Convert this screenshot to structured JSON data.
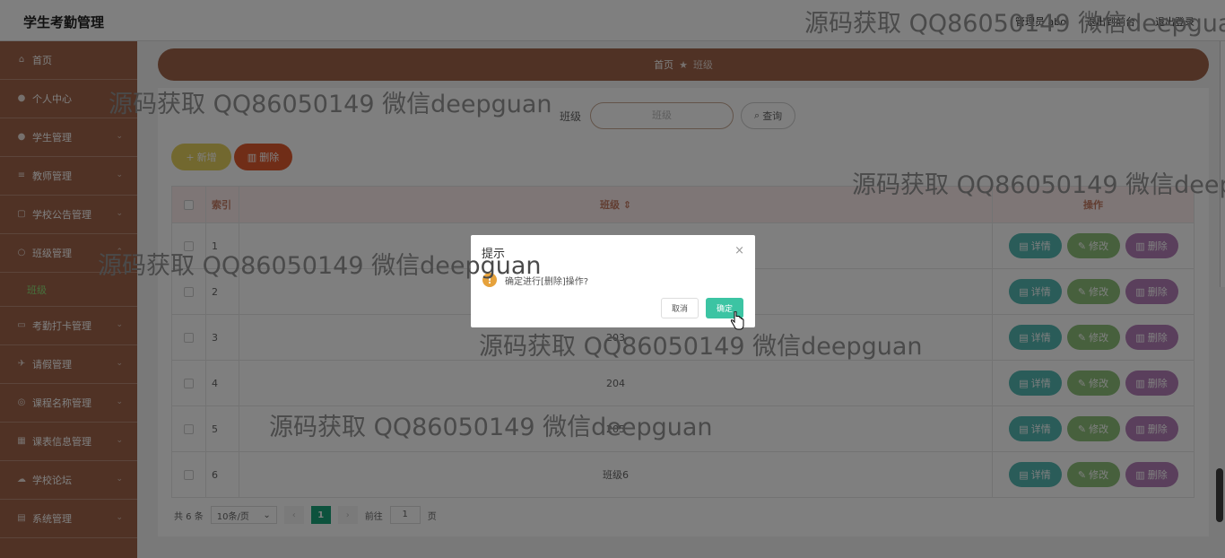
{
  "header": {
    "app_title": "学生考勤管理",
    "user": "管理员 abo",
    "logout": "退出到前台",
    "exit": "退出登录"
  },
  "sidebar": {
    "items": [
      {
        "label": "首页",
        "icon": "home-icon",
        "has_arrow": false
      },
      {
        "label": "个人中心",
        "icon": "user-icon",
        "has_arrow": false
      },
      {
        "label": "学生管理",
        "icon": "student-icon",
        "has_arrow": true
      },
      {
        "label": "教师管理",
        "icon": "teacher-icon",
        "has_arrow": true
      },
      {
        "label": "学校公告管理",
        "icon": "notice-icon",
        "has_arrow": true
      },
      {
        "label": "班级管理",
        "icon": "class-icon",
        "has_arrow": true
      },
      {
        "label": "考勤打卡管理",
        "icon": "checkin-icon",
        "has_arrow": true
      },
      {
        "label": "请假管理",
        "icon": "leave-icon",
        "has_arrow": true
      },
      {
        "label": "课程名称管理",
        "icon": "course-icon",
        "has_arrow": true
      },
      {
        "label": "课表信息管理",
        "icon": "schedule-icon",
        "has_arrow": true
      },
      {
        "label": "学校论坛",
        "icon": "forum-icon",
        "has_arrow": true
      },
      {
        "label": "系统管理",
        "icon": "system-icon",
        "has_arrow": true
      }
    ],
    "submenu_label": "班级"
  },
  "breadcrumb": {
    "home": "首页",
    "separator": "★",
    "current": "班级"
  },
  "search": {
    "label": "班级",
    "placeholder": "班级",
    "button": "查询"
  },
  "actions": {
    "add": "新增",
    "delete": "删除"
  },
  "table": {
    "headers": {
      "index": "索引",
      "name": "班级 ⇕",
      "ops": "操作"
    },
    "rows": [
      {
        "index": "1",
        "name": ""
      },
      {
        "index": "2",
        "name": ""
      },
      {
        "index": "3",
        "name": "203"
      },
      {
        "index": "4",
        "name": "204"
      },
      {
        "index": "5",
        "name": "205"
      },
      {
        "index": "6",
        "name": "班级6"
      }
    ],
    "op_labels": {
      "detail": "详情",
      "edit": "修改",
      "delete": "删除"
    }
  },
  "pagination": {
    "total": "共 6 条",
    "page_size": "10条/页",
    "current": "1",
    "goto_prefix": "前往",
    "goto_value": "1",
    "goto_suffix": "页"
  },
  "dialog": {
    "title": "提示",
    "message": "确定进行[删除]操作?",
    "cancel": "取消",
    "confirm": "确定"
  },
  "watermark": "源码获取 QQ86050149 微信deepguan",
  "colors": {
    "sidebar": "#a0654a",
    "accent_green": "#3cc4a3",
    "warning": "#e6a23c"
  }
}
